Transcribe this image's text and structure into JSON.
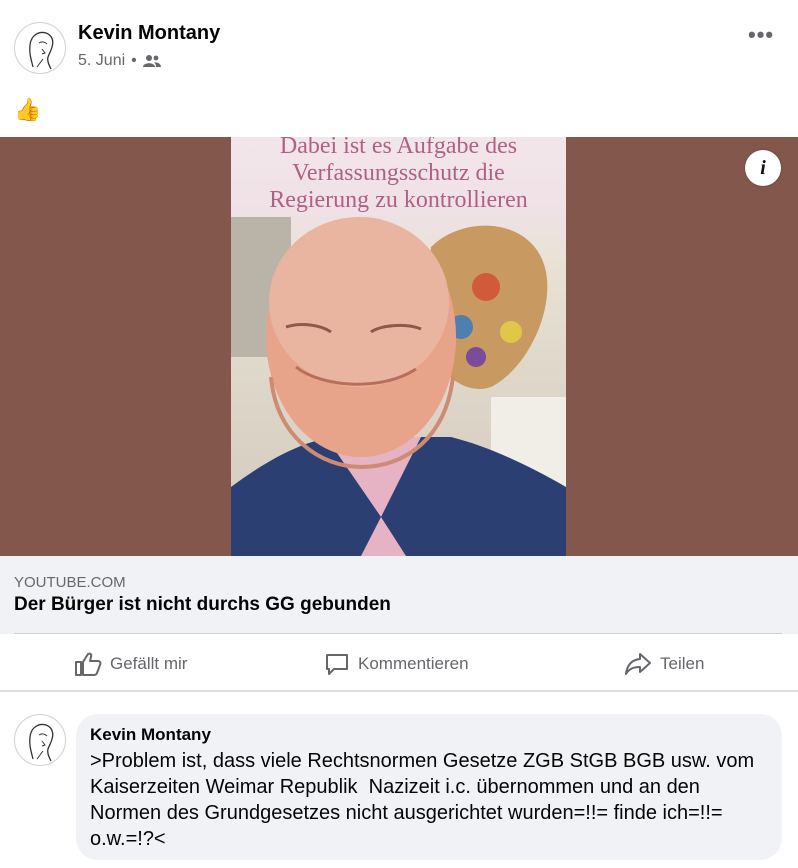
{
  "post": {
    "author": "Kevin Montany",
    "date": "5. Juni",
    "separator": "•",
    "audience_icon": "friends-icon",
    "more_icon": "more-options-icon",
    "more_glyph": "•••",
    "text": "👍"
  },
  "media": {
    "caption_lines": [
      "Dabei ist es Aufgabe des",
      "Verfassungsschutz die",
      "Regierung zu kontrollieren"
    ],
    "info_glyph": "i",
    "background_color": "#83574c",
    "caption_color": "#b06086"
  },
  "link_preview": {
    "domain": "YOUTUBE.COM",
    "title": "Der Bürger ist nicht durchs GG gebunden"
  },
  "actions": {
    "like_label": "Gefällt mir",
    "comment_label": "Kommentieren",
    "share_label": "Teilen"
  },
  "comment": {
    "author": "Kevin Montany",
    "text": ">Problem ist, dass viele Rechtsnormen Gesetze ZGB StGB BGB usw. vom Kaiserzeiten Weimar Republik  Nazizeit i.c. übernommen und an den Normen des Grundgesetzes nicht ausgerichtet wurden=!!= finde ich=!!= o.w.=!?<"
  }
}
